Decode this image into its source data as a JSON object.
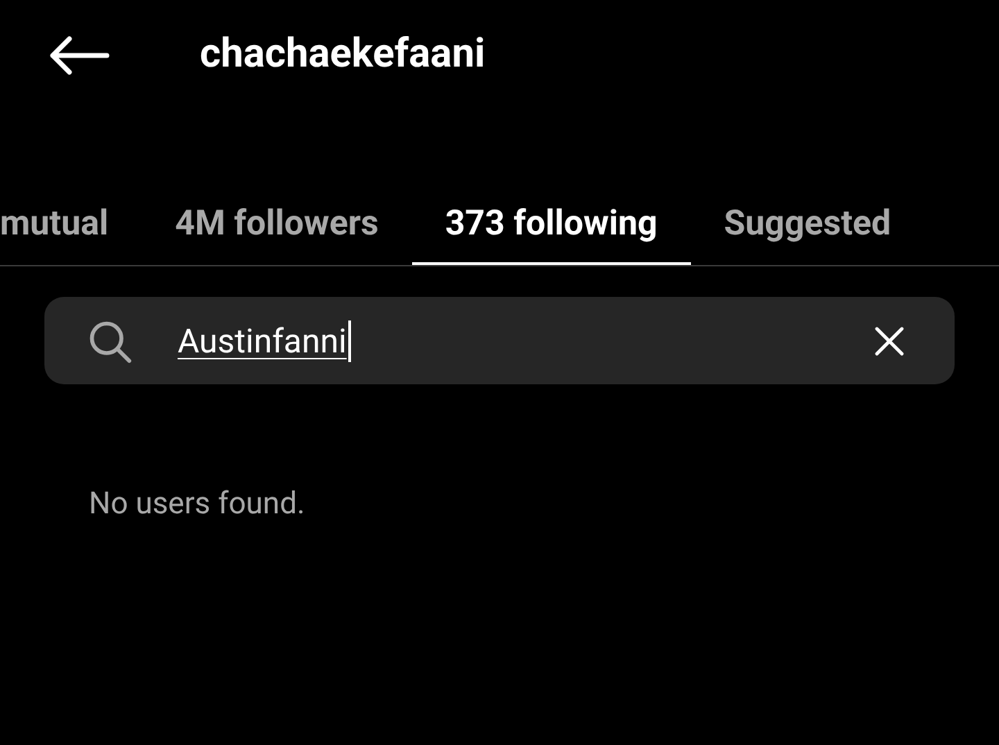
{
  "header": {
    "title": "chachaekefaani"
  },
  "tabs": [
    {
      "label": "mutual",
      "selected": false
    },
    {
      "label": "4M followers",
      "selected": false
    },
    {
      "label": "373 following",
      "selected": true
    },
    {
      "label": "Suggested",
      "selected": false
    }
  ],
  "search": {
    "value": "Austinfanni"
  },
  "empty_message": "No users found."
}
